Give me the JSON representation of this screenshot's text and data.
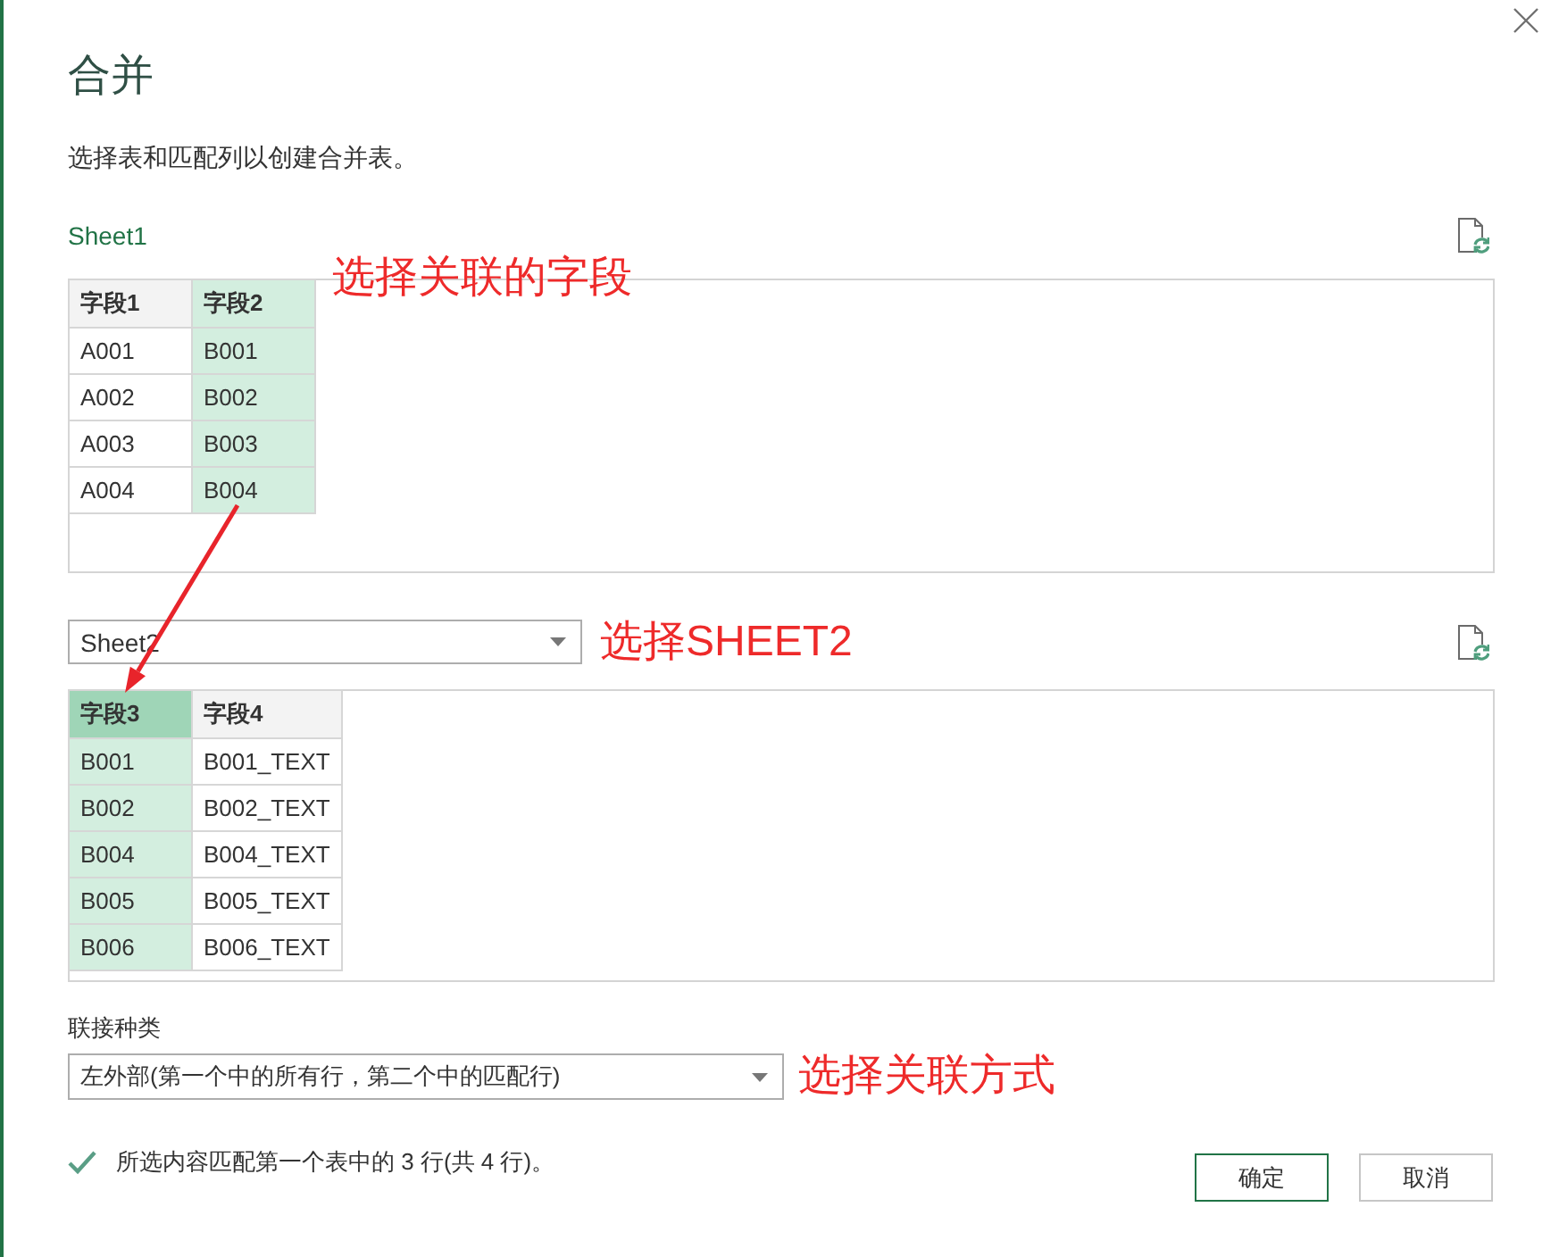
{
  "dialog": {
    "title": "合并",
    "description": "选择表和匹配列以创建合并表。"
  },
  "first_table": {
    "label": "Sheet1",
    "focused": false,
    "annotation": "选择关联的字段",
    "columns": [
      {
        "name": "字段1",
        "selected": false
      },
      {
        "name": "字段2",
        "selected": true
      }
    ],
    "rows": [
      [
        "A001",
        "B001"
      ],
      [
        "A002",
        "B002"
      ],
      [
        "A003",
        "B003"
      ],
      [
        "A004",
        "B004"
      ]
    ]
  },
  "second_table": {
    "source": "Sheet2",
    "focused": true,
    "annotation": "选择SHEET2",
    "columns": [
      {
        "name": "字段3",
        "selected": true
      },
      {
        "name": "字段4",
        "selected": false
      }
    ],
    "rows": [
      [
        "B001",
        "B001_TEXT"
      ],
      [
        "B002",
        "B002_TEXT"
      ],
      [
        "B004",
        "B004_TEXT"
      ],
      [
        "B005",
        "B005_TEXT"
      ],
      [
        "B006",
        "B006_TEXT"
      ]
    ]
  },
  "join_kind": {
    "label": "联接种类",
    "value": "左外部(第一个中的所有行，第二个中的匹配行)",
    "annotation": "选择关联方式"
  },
  "status": {
    "matched": true,
    "text": "所选内容匹配第一个表中的 3 行(共 4 行)。"
  },
  "buttons": [
    {
      "label": "确定",
      "kind": "primary"
    },
    {
      "label": "取消",
      "kind": "secondary"
    }
  ]
}
